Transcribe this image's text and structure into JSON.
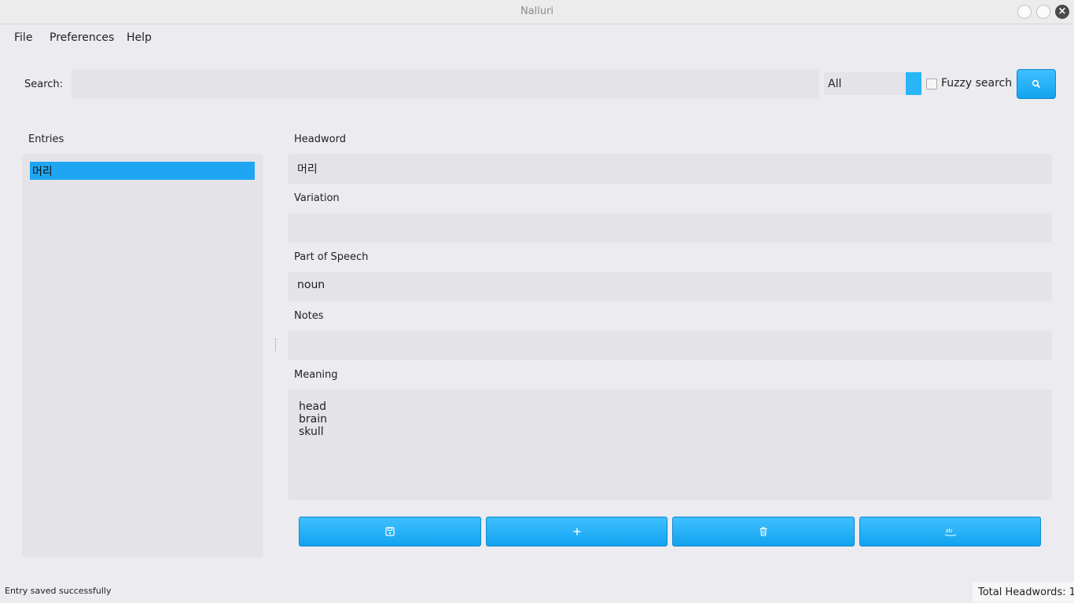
{
  "window": {
    "title": "Nalluri"
  },
  "menu": {
    "items": [
      "File",
      "Preferences",
      "Help"
    ]
  },
  "search": {
    "label": "Search:",
    "value": "",
    "scope_selected": "All",
    "fuzzy_label": "Fuzzy search",
    "fuzzy_checked": false,
    "button_icon": "search-icon"
  },
  "entries": {
    "label": "Entries",
    "items": [
      "머리"
    ],
    "selected_index": 0
  },
  "form": {
    "headword": {
      "label": "Headword",
      "value": "머리"
    },
    "variation": {
      "label": "Variation",
      "value": ""
    },
    "part_of_speech": {
      "label": "Part of Speech",
      "value": "noun"
    },
    "notes": {
      "label": "Notes",
      "value": ""
    },
    "meaning": {
      "label": "Meaning",
      "value": "head\nbrain\nskull"
    }
  },
  "actions": [
    {
      "icon": "save-icon"
    },
    {
      "icon": "plus-icon"
    },
    {
      "icon": "trash-icon"
    },
    {
      "icon": "spellcheck-icon"
    }
  ],
  "status": {
    "message": "Entry saved successfully",
    "total": "Total Headwords: 1"
  },
  "colors": {
    "accent": "#29b6f6",
    "selection": "#1ea6f3",
    "field_bg": "#e3e3e8",
    "window_bg": "#ebebf0"
  }
}
